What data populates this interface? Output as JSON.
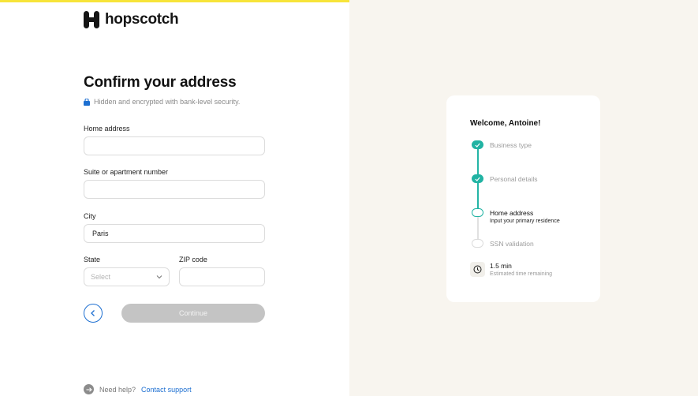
{
  "brand": {
    "name": "hopscotch"
  },
  "form": {
    "title": "Confirm your address",
    "security_note": "Hidden and encrypted with bank-level security.",
    "home_address": {
      "label": "Home address",
      "value": ""
    },
    "suite": {
      "label": "Suite or apartment number",
      "value": ""
    },
    "city": {
      "label": "City",
      "value": "Paris"
    },
    "state": {
      "label": "State",
      "placeholder": "Select"
    },
    "zip": {
      "label": "ZIP code",
      "value": ""
    },
    "continue_label": "Continue"
  },
  "help": {
    "prompt": "Need help?",
    "link": "Contact support"
  },
  "progress": {
    "welcome": "Welcome, Antoine!",
    "steps": [
      {
        "label": "Business type",
        "status": "done"
      },
      {
        "label": "Personal details",
        "status": "done"
      },
      {
        "label": "Home address",
        "sub": "Input your primary residence",
        "status": "current"
      },
      {
        "label": "SSN validation",
        "status": "todo"
      }
    ],
    "time": {
      "value": "1.5 min",
      "sub": "Estimated time remaining"
    }
  },
  "colors": {
    "accent_yellow": "#f7e43a",
    "teal": "#21b3a3",
    "link_blue": "#1d6fd1",
    "right_bg": "#f8f5ef"
  }
}
